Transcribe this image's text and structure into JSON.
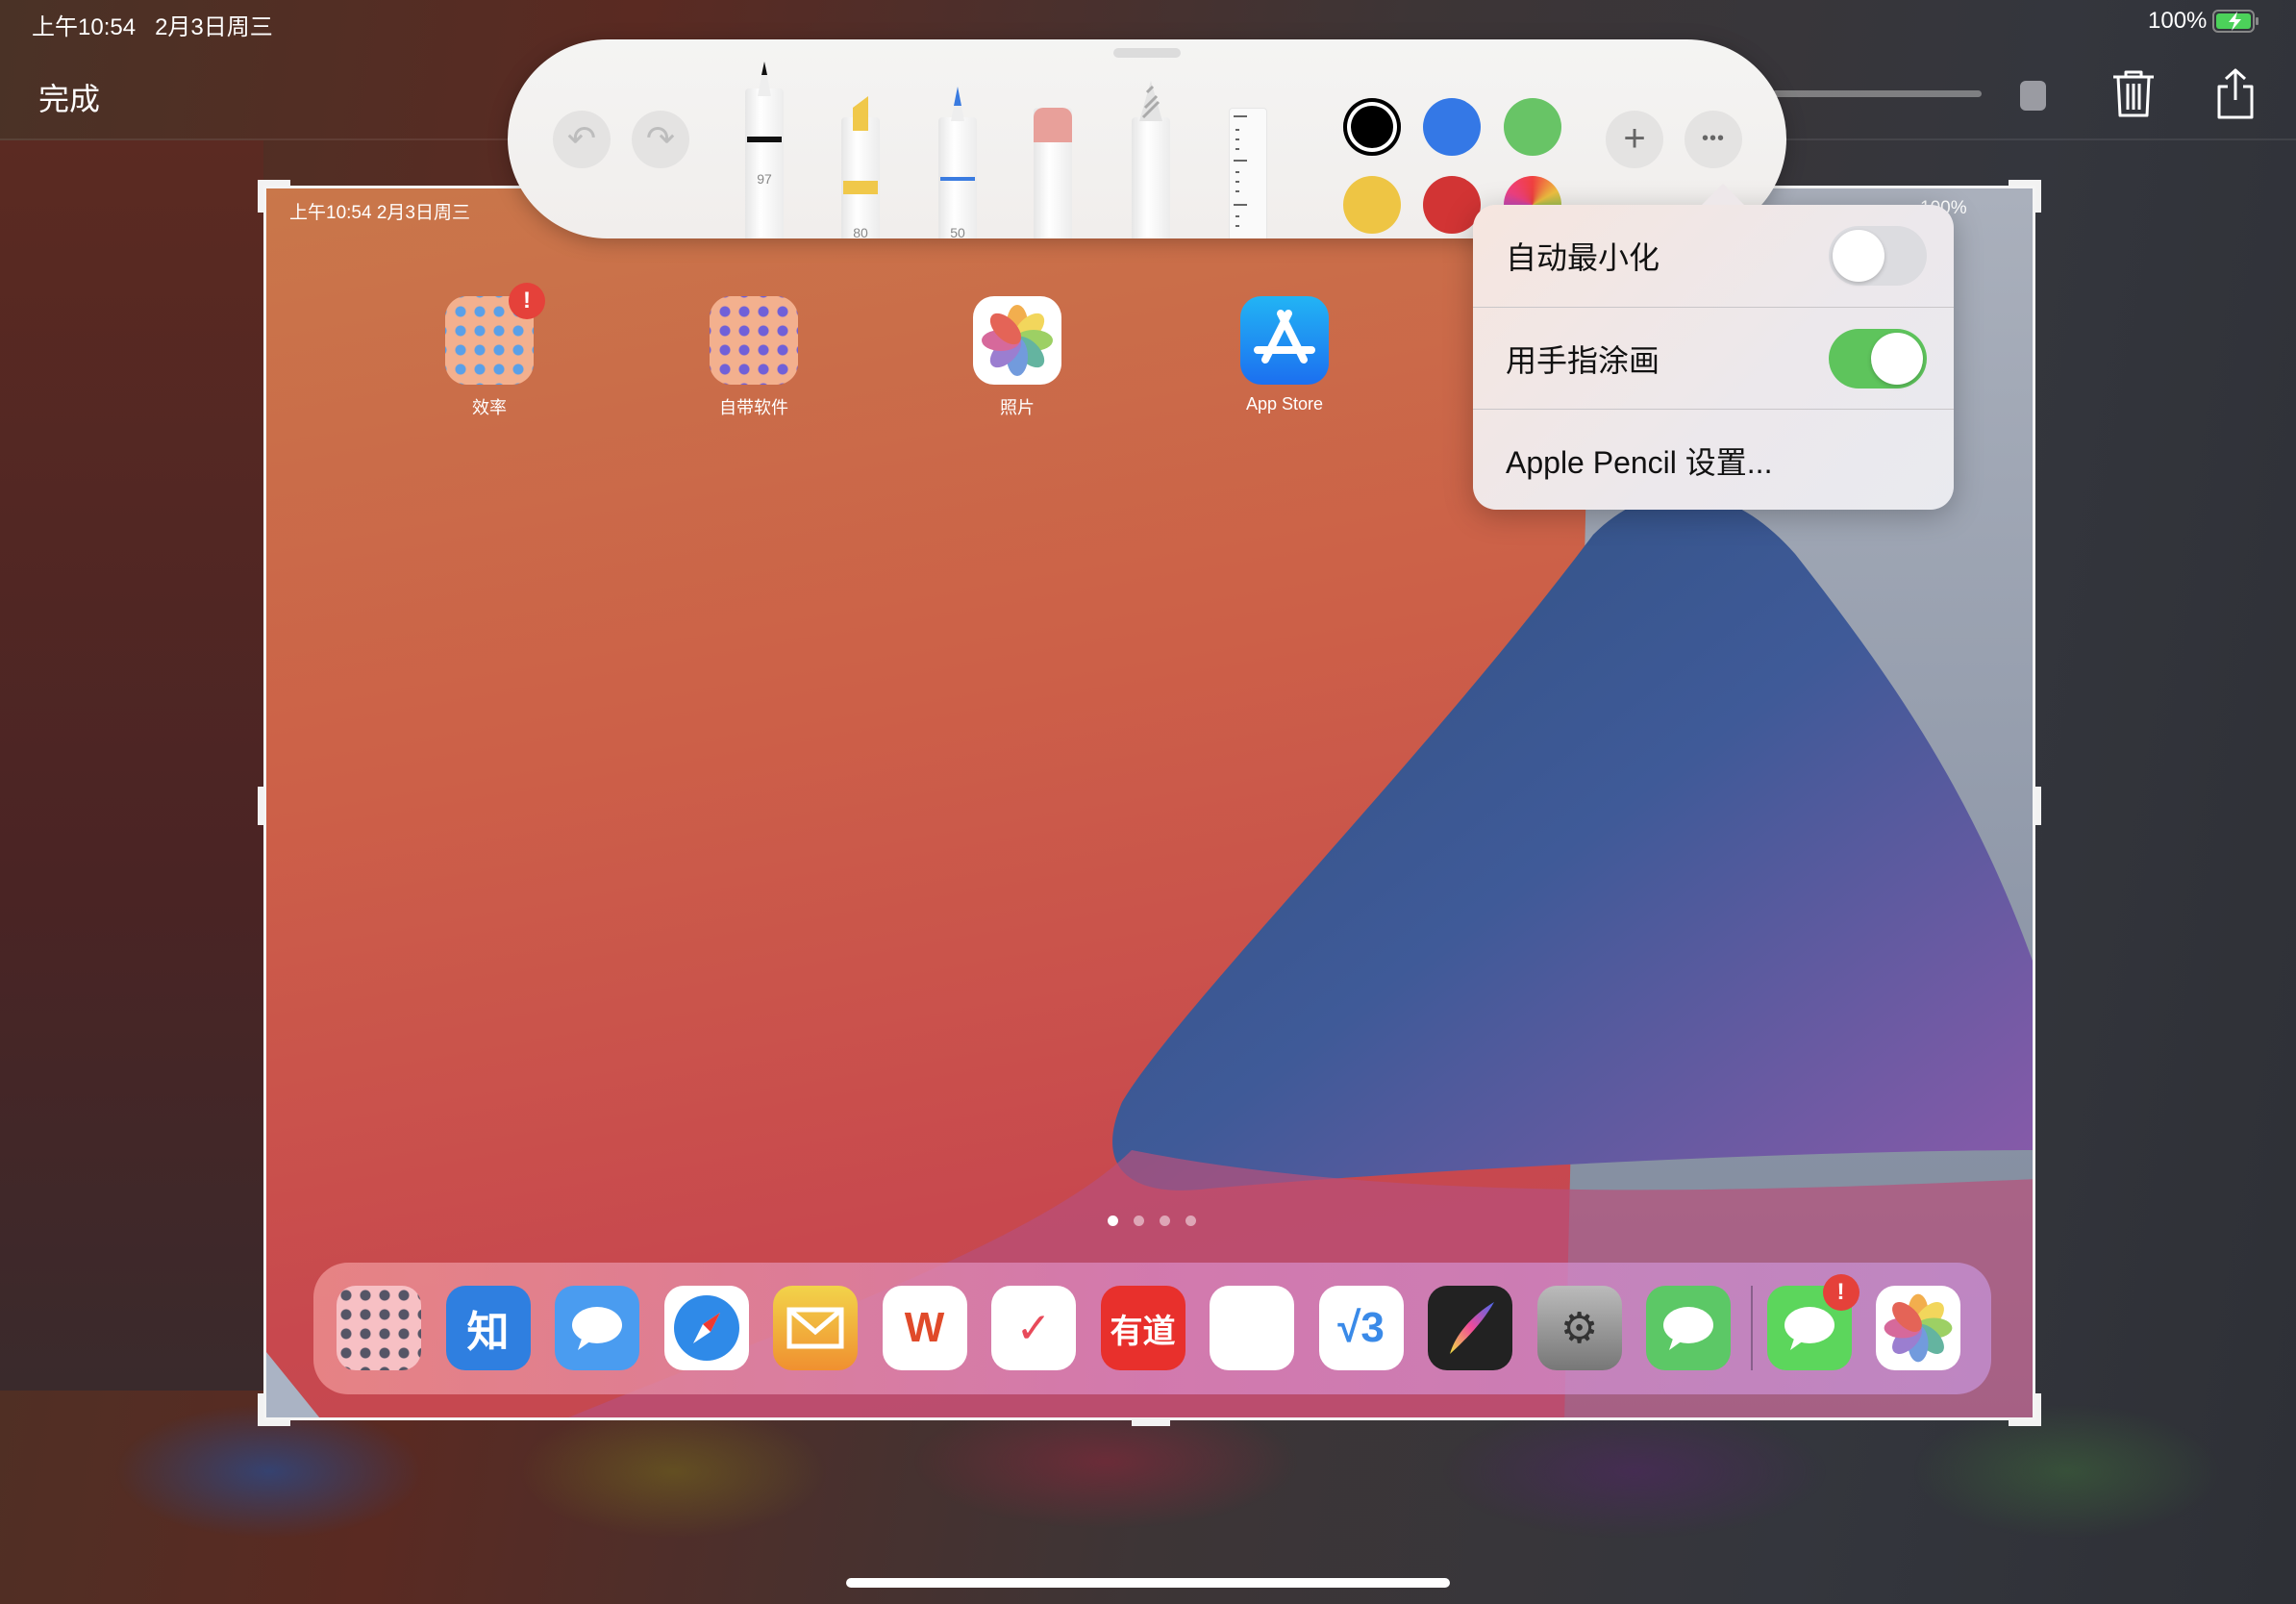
{
  "status_bar": {
    "time": "上午10:54",
    "date": "2月3日周三",
    "battery": "100%",
    "battery_level": 1.0,
    "charging": true
  },
  "nav": {
    "done_label": "完成",
    "icons": [
      "slider",
      "square",
      "trash-icon",
      "share-icon"
    ]
  },
  "toolbar": {
    "undo_icon": "undo-icon",
    "redo_icon": "redo-icon",
    "tools": [
      {
        "name": "pen",
        "width_label": "97",
        "color": "#111111"
      },
      {
        "name": "highlighter",
        "width_label": "80",
        "color": "#f0c84a"
      },
      {
        "name": "pencil",
        "width_label": "50",
        "color": "#3a7be0"
      },
      {
        "name": "eraser",
        "width_label": "",
        "color": "#e8a09a"
      },
      {
        "name": "lasso",
        "width_label": "",
        "color": "#cccccc"
      },
      {
        "name": "ruler",
        "width_label": "",
        "color": "#ffffff"
      }
    ],
    "colors": [
      "#000000",
      "#3478e6",
      "#68c466",
      "#eec544",
      "#d23434",
      "multicolor"
    ],
    "selected_color": "#000000",
    "add_label": "+",
    "more_label": "•••"
  },
  "menu": {
    "items": [
      {
        "label": "自动最小化",
        "toggle": false
      },
      {
        "label": "用手指涂画",
        "toggle": true
      },
      {
        "label": "Apple Pencil 设置..."
      }
    ],
    "toggle_on_color": "#5ec45c"
  },
  "screenshot": {
    "status": "上午10:54   2月3日周三",
    "battery": "100%",
    "apps": [
      {
        "label": "效率",
        "badge": "!"
      },
      {
        "label": "自带软件"
      },
      {
        "label": "照片"
      },
      {
        "label": "App Store"
      }
    ],
    "page_count": 4,
    "current_page": 1,
    "dock": [
      {
        "name": "folder",
        "glyph": ""
      },
      {
        "name": "zhihu",
        "glyph": "知"
      },
      {
        "name": "chat-app",
        "glyph": ""
      },
      {
        "name": "safari",
        "glyph": ""
      },
      {
        "name": "mail",
        "glyph": ""
      },
      {
        "name": "wps",
        "glyph": "W"
      },
      {
        "name": "ticktick",
        "glyph": "✓"
      },
      {
        "name": "youdao",
        "glyph": "有道"
      },
      {
        "name": "notes-pen",
        "glyph": ""
      },
      {
        "name": "v3",
        "glyph": "√3"
      },
      {
        "name": "procreate",
        "glyph": ""
      },
      {
        "name": "settings",
        "glyph": "⚙"
      },
      {
        "name": "wechat",
        "glyph": ""
      },
      {
        "name": "messages",
        "glyph": "",
        "badge": "!"
      },
      {
        "name": "photos",
        "glyph": ""
      }
    ]
  }
}
